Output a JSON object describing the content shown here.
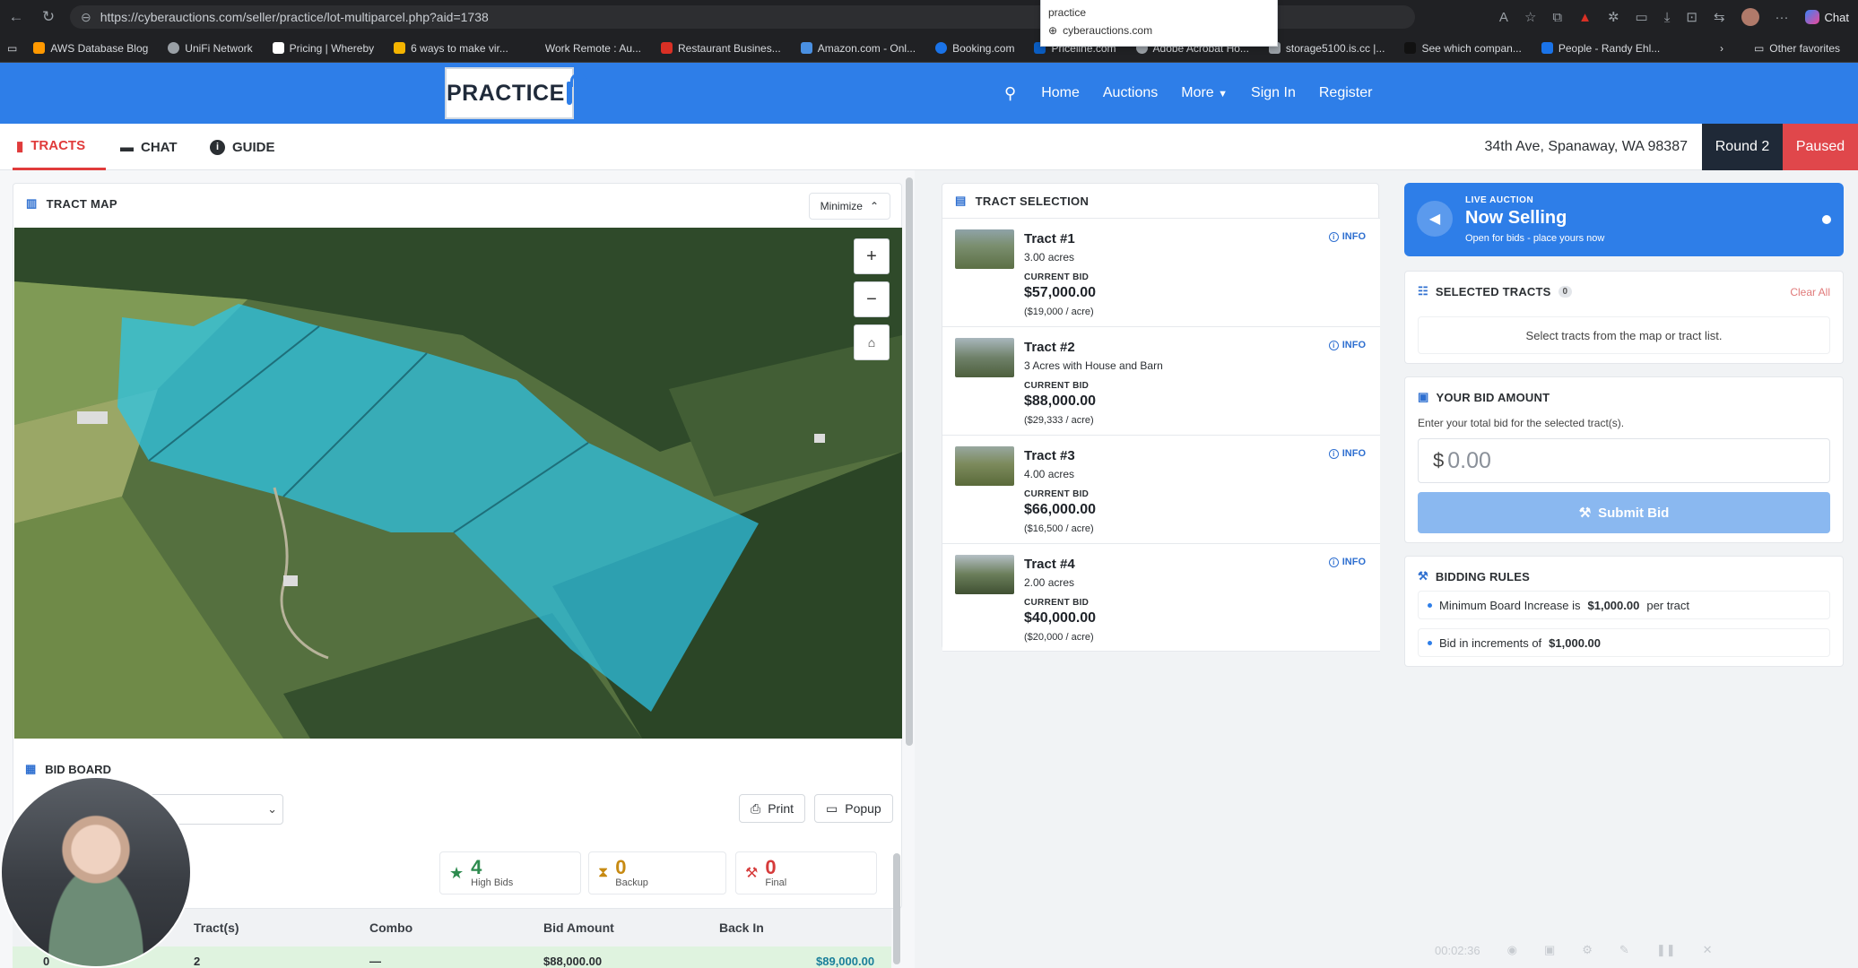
{
  "browser": {
    "url": "https://cyberauctions.com/seller/practice/lot-multiparcel.php?aid=1738",
    "dropdown_query": "practice",
    "dropdown_suggestion": "cyberauctions.com",
    "chat_label": "Chat"
  },
  "bookmarks": [
    {
      "label": "AWS Database Blog",
      "color": "#ff9900"
    },
    {
      "label": "UniFi Network",
      "color": "#9aa0a6"
    },
    {
      "label": "Pricing | Whereby",
      "color": "#ffffff"
    },
    {
      "label": "6 ways to make vir...",
      "color": "#f4b400"
    },
    {
      "label": "Work Remote : Au...",
      "color": "#202124"
    },
    {
      "label": "Restaurant Busines...",
      "color": "#d93025"
    },
    {
      "label": "Amazon.com - Onl...",
      "color": "#4a90e2"
    },
    {
      "label": "Booking.com",
      "color": "#1a73e8"
    },
    {
      "label": "Priceline.com",
      "color": "#0a5dc2"
    },
    {
      "label": "Adobe Acrobat Ho...",
      "color": "#9aa0a6"
    },
    {
      "label": "storage5100.is.cc |...",
      "color": "#9aa0a6"
    },
    {
      "label": "See which compan...",
      "color": "#111111"
    },
    {
      "label": "People - Randy Ehl...",
      "color": "#1a73e8"
    }
  ],
  "bookmarks_other": "Other favorites",
  "header": {
    "logo_text": "PRACTICE",
    "nav": [
      "Home",
      "Auctions",
      "More",
      "Sign In",
      "Register"
    ]
  },
  "tabs": [
    "TRACTS",
    "CHAT",
    "GUIDE"
  ],
  "status": {
    "address": "34th Ave, Spanaway, WA 98387",
    "round": "Round 2",
    "state": "Paused"
  },
  "tract_map": {
    "title": "TRACT MAP",
    "minimize_label": "Minimize"
  },
  "bid_board": {
    "title": "BID BOARD",
    "print_label": "Print",
    "popup_label": "Popup",
    "stats": [
      {
        "value": "4",
        "label": "High Bids",
        "color": "#2e8b4f"
      },
      {
        "value": "0",
        "label": "Backup",
        "color": "#c78a12"
      },
      {
        "value": "0",
        "label": "Final",
        "color": "#d63b3b"
      }
    ],
    "columns": [
      "Tract(s)",
      "Combo",
      "Bid Amount",
      "Back In"
    ],
    "row": {
      "rank": "0",
      "tracts": "2",
      "combo": "—",
      "amount": "$88,000.00",
      "back_in": "$89,000.00"
    }
  },
  "tract_selection": {
    "title": "TRACT SELECTION",
    "current_bid_label": "CURRENT BID",
    "info_label": "INFO",
    "tracts": [
      {
        "name": "Tract #1",
        "desc": "3.00 acres",
        "bid": "$57,000.00",
        "per_acre": "($19,000 / acre)"
      },
      {
        "name": "Tract #2",
        "desc": "3 Acres with House and Barn",
        "bid": "$88,000.00",
        "per_acre": "($29,333 / acre)"
      },
      {
        "name": "Tract #3",
        "desc": "4.00 acres",
        "bid": "$66,000.00",
        "per_acre": "($16,500 / acre)"
      },
      {
        "name": "Tract #4",
        "desc": "2.00 acres",
        "bid": "$40,000.00",
        "per_acre": "($20,000 / acre)"
      }
    ]
  },
  "live": {
    "label": "LIVE AUCTION",
    "title": "Now Selling",
    "subtitle": "Open for bids - place yours now"
  },
  "selected": {
    "title": "SELECTED TRACTS",
    "count": "0",
    "clear_label": "Clear All",
    "empty_text": "Select tracts from the map or tract list."
  },
  "bid": {
    "title": "YOUR BID AMOUNT",
    "hint": "Enter your total bid for the selected tract(s).",
    "currency": "$",
    "placeholder": "0.00",
    "submit_label": "Submit Bid"
  },
  "rules": {
    "title": "BIDDING RULES",
    "r1_prefix": "Minimum Board Increase is",
    "r1_value": "$1,000.00",
    "r1_suffix": "per tract",
    "r2_prefix": "Bid in increments of",
    "r2_value": "$1,000.00"
  },
  "video": {
    "time": "00:02:36"
  },
  "colors": {
    "brand": "#2e7ee8",
    "paused": "#e0474b",
    "tract_fill": "#2ec4e6"
  }
}
